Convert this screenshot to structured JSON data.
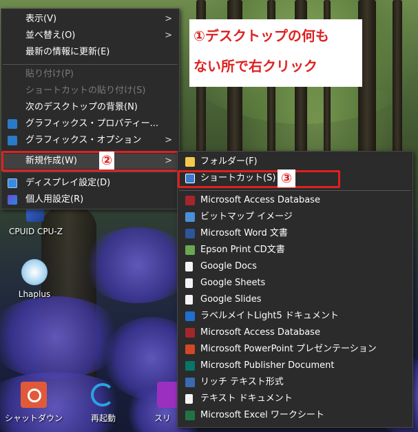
{
  "annotation": {
    "line1": "①デスクトップの何も",
    "line2": "ない所で右クリック"
  },
  "markers": {
    "m2": "②",
    "m3": "③"
  },
  "context_menu": {
    "items": [
      {
        "label": "表示(V)",
        "arrow": ">"
      },
      {
        "label": "並べ替え(O)",
        "arrow": ">"
      },
      {
        "label": "最新の情報に更新(E)"
      },
      {
        "label": "貼り付け(P)",
        "disabled": true
      },
      {
        "label": "ショートカットの貼り付け(S)",
        "disabled": true
      },
      {
        "label": "次のデスクトップの背景(N)"
      },
      {
        "label": "グラフィックス・プロパティー..."
      },
      {
        "label": "グラフィックス・オプション",
        "arrow": ">"
      },
      {
        "label": "新規作成(W)",
        "arrow": ">"
      },
      {
        "label": "ディスプレイ設定(D)"
      },
      {
        "label": "個人用設定(R)"
      }
    ]
  },
  "submenu": {
    "items": [
      {
        "label": "フォルダー(F)",
        "icon": "folder-icon"
      },
      {
        "label": "ショートカット(S)",
        "icon": "shortcut-icon"
      },
      {
        "label": "Microsoft Access Database",
        "icon": "access-icon"
      },
      {
        "label": "ビットマップ イメージ",
        "icon": "bitmap-icon"
      },
      {
        "label": "Microsoft Word 文書",
        "icon": "word-icon"
      },
      {
        "label": "Epson Print CD文書",
        "icon": "epson-icon"
      },
      {
        "label": "Google Docs",
        "icon": "document-icon"
      },
      {
        "label": "Google Sheets",
        "icon": "document-icon"
      },
      {
        "label": "Google Slides",
        "icon": "document-icon"
      },
      {
        "label": "ラベルメイトLight5 ドキュメント",
        "icon": "labelmate-icon"
      },
      {
        "label": "Microsoft Access Database",
        "icon": "access-icon"
      },
      {
        "label": "Microsoft PowerPoint プレゼンテーション",
        "icon": "powerpoint-icon"
      },
      {
        "label": "Microsoft Publisher Document",
        "icon": "publisher-icon"
      },
      {
        "label": "リッチ テキスト形式",
        "icon": "wordpad-icon"
      },
      {
        "label": "テキスト ドキュメント",
        "icon": "text-icon"
      },
      {
        "label": "Microsoft Excel ワークシート",
        "icon": "excel-icon"
      }
    ]
  },
  "desktop_icons": [
    {
      "label": "CPUID CPU-Z",
      "icon": "cpuz-icon"
    },
    {
      "label": "Lhaplus",
      "icon": "lhaplus-icon"
    },
    {
      "label": "シャットダウン",
      "icon": "shutdown-icon"
    },
    {
      "label": "再起動",
      "icon": "restart-icon"
    },
    {
      "label": "スリ",
      "icon": "sleep-icon"
    }
  ],
  "colors": {
    "annotation_red": "#e02020",
    "menu_bg": "#2b2b2b",
    "disabled_text": "#7b7b7b"
  }
}
